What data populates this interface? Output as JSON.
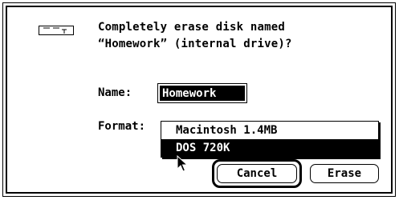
{
  "dialog": {
    "message_line1": "Completely erase disk named",
    "message_line2": "“Homework” (internal drive)?",
    "icon": "floppy-disk-icon"
  },
  "name_field": {
    "label": "Name:",
    "value": "Homework"
  },
  "format_menu": {
    "label": "Format:",
    "options": [
      "Macintosh 1.4MB",
      "DOS 720K"
    ],
    "highlighted": "DOS 720K"
  },
  "buttons": {
    "cancel": "Cancel",
    "erase": "Erase"
  },
  "colors": {
    "background": "#ffffff",
    "foreground": "#000000"
  }
}
